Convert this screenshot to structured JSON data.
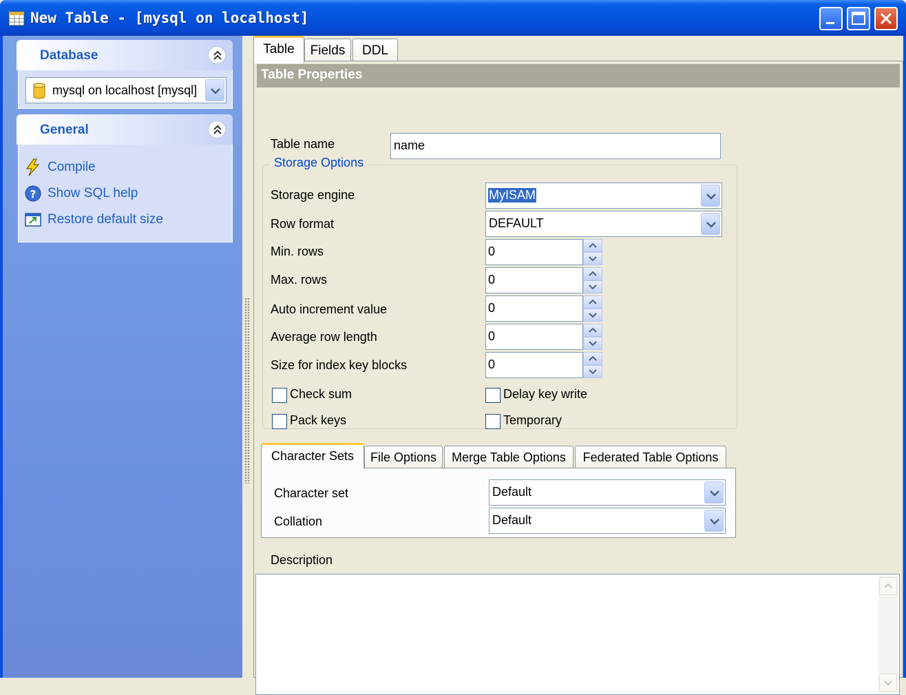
{
  "window": {
    "title": "New Table - [mysql on localhost]",
    "colors": {
      "titlebar": "#0453dc",
      "accent": "#215dc6",
      "selection": "#316ac5"
    }
  },
  "sidebar": {
    "database_panel": {
      "title": "Database",
      "selected_database": "mysql on localhost [mysql]"
    },
    "general_panel": {
      "title": "General",
      "items": [
        {
          "label": "Compile",
          "icon": "lightning-icon"
        },
        {
          "label": "Show SQL help",
          "icon": "help-icon"
        },
        {
          "label": "Restore default size",
          "icon": "restore-size-icon"
        }
      ]
    }
  },
  "tabs": [
    {
      "label": "Table"
    },
    {
      "label": "Fields"
    },
    {
      "label": "DDL"
    }
  ],
  "table_properties": {
    "header": "Table Properties",
    "table_name_label": "Table name",
    "table_name_value": "name",
    "storage_group_title": "Storage Options",
    "storage_engine_label": "Storage engine",
    "storage_engine_value": "MyISAM",
    "row_format_label": "Row format",
    "row_format_value": "DEFAULT",
    "min_rows_label": "Min. rows",
    "min_rows_value": "0",
    "max_rows_label": "Max. rows",
    "max_rows_value": "0",
    "auto_increment_label": "Auto increment value",
    "auto_increment_value": "0",
    "avg_row_length_label": "Average row length",
    "avg_row_length_value": "0",
    "index_key_blocks_label": "Size for index key blocks",
    "index_key_blocks_value": "0",
    "check_sum_label": "Check sum",
    "delay_key_write_label": "Delay key write",
    "pack_keys_label": "Pack keys",
    "temporary_label": "Temporary"
  },
  "sub_tabs": [
    {
      "label": "Character Sets"
    },
    {
      "label": "File Options"
    },
    {
      "label": "Merge Table Options"
    },
    {
      "label": "Federated Table Options"
    }
  ],
  "character_sets": {
    "character_set_label": "Character set",
    "character_set_value": "Default",
    "collation_label": "Collation",
    "collation_value": "Default"
  },
  "description": {
    "label": "Description",
    "value": ""
  }
}
